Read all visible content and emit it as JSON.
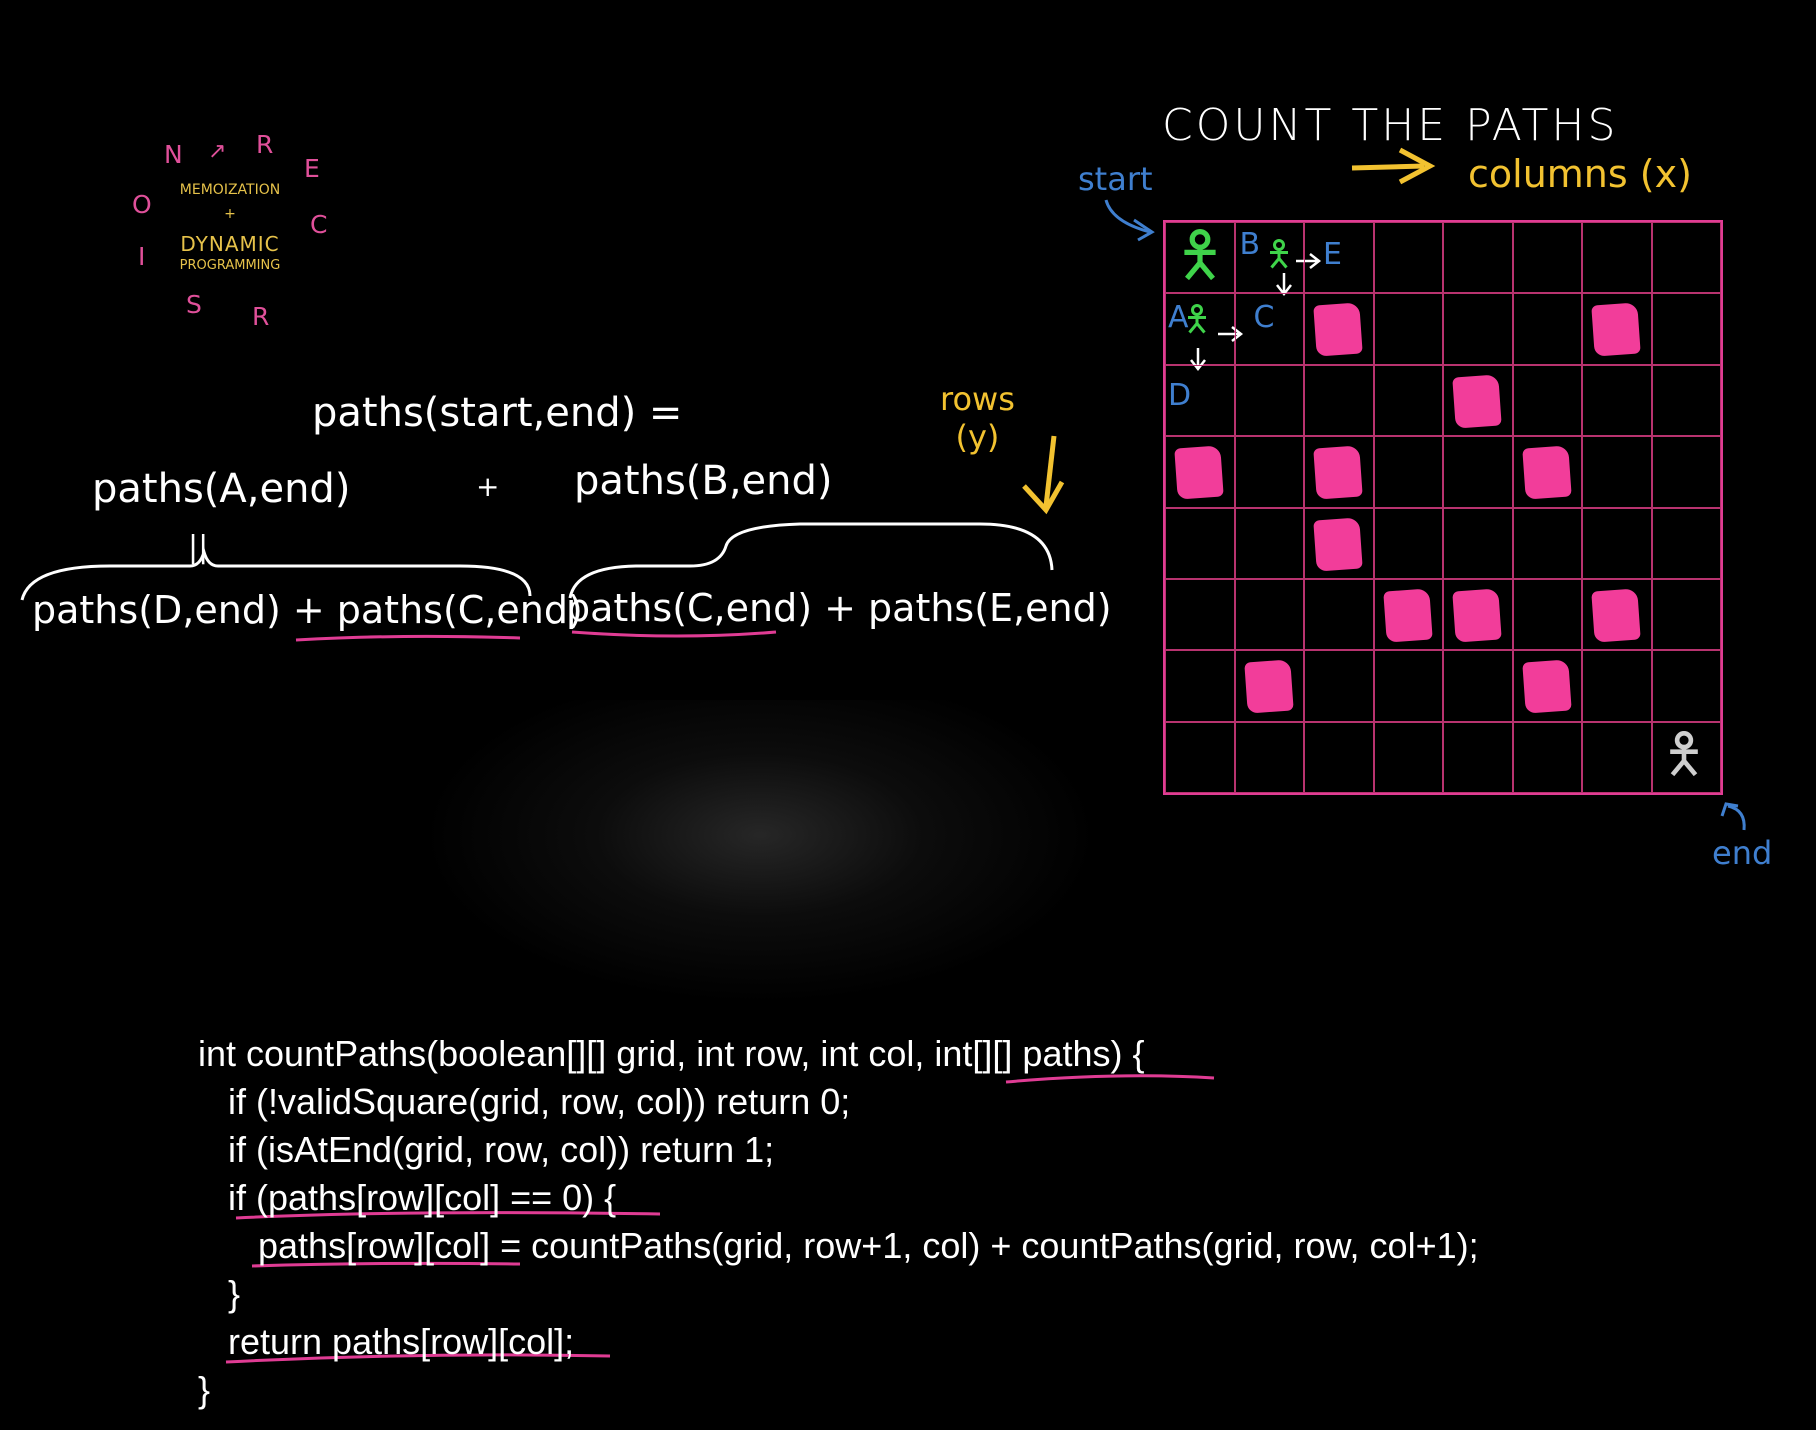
{
  "logo": {
    "ring_letters": [
      "N",
      "R",
      "E",
      "C",
      "R",
      "S",
      "I",
      "O"
    ],
    "line1": "MEMOIZATION",
    "line2": "+",
    "line3": "DYNAMIC",
    "line4": "PROGRAMMING"
  },
  "grid": {
    "title": "COUNT THE PATHS",
    "columns_label": "columns (x)",
    "rows_label_1": "rows",
    "rows_label_2": "(y)",
    "start_label": "start",
    "end_label": "end",
    "rows": 8,
    "cols": 8,
    "blocked": [
      [
        1,
        2
      ],
      [
        1,
        6
      ],
      [
        2,
        4
      ],
      [
        3,
        0
      ],
      [
        3,
        2
      ],
      [
        3,
        5
      ],
      [
        4,
        2
      ],
      [
        5,
        3
      ],
      [
        5,
        4
      ],
      [
        5,
        6
      ],
      [
        6,
        1
      ],
      [
        6,
        5
      ]
    ],
    "cell_labels": {
      "A": "A",
      "B": "B",
      "C": "C",
      "D": "D",
      "E": "E"
    },
    "colors": {
      "line": "#e03c94",
      "block": "#f23d9a",
      "figure_start": "#3fd44a",
      "figure_end": "#cfcfcf",
      "label": "#3f7fcf",
      "accent": "#f2c230"
    }
  },
  "formulas": {
    "top": "paths(start,end) =",
    "left": "paths(A,end)",
    "plus": "+",
    "right": "paths(B,end)",
    "equals_mark": "||",
    "left_expand": "paths(D,end) + paths(C,end)",
    "right_expand": "paths(C,end) + paths(E,end)"
  },
  "code": {
    "lines": [
      "int countPaths(boolean[][] grid, int row, int col, int[][] paths) {",
      "   if (!validSquare(grid, row, col)) return 0;",
      "   if (isAtEnd(grid, row, col)) return 1;",
      "   if (paths[row][col] == 0) {",
      "      paths[row][col] = countPaths(grid, row+1, col) + countPaths(grid, row, col+1);",
      "   }",
      "   return paths[row][col];",
      "}"
    ]
  }
}
